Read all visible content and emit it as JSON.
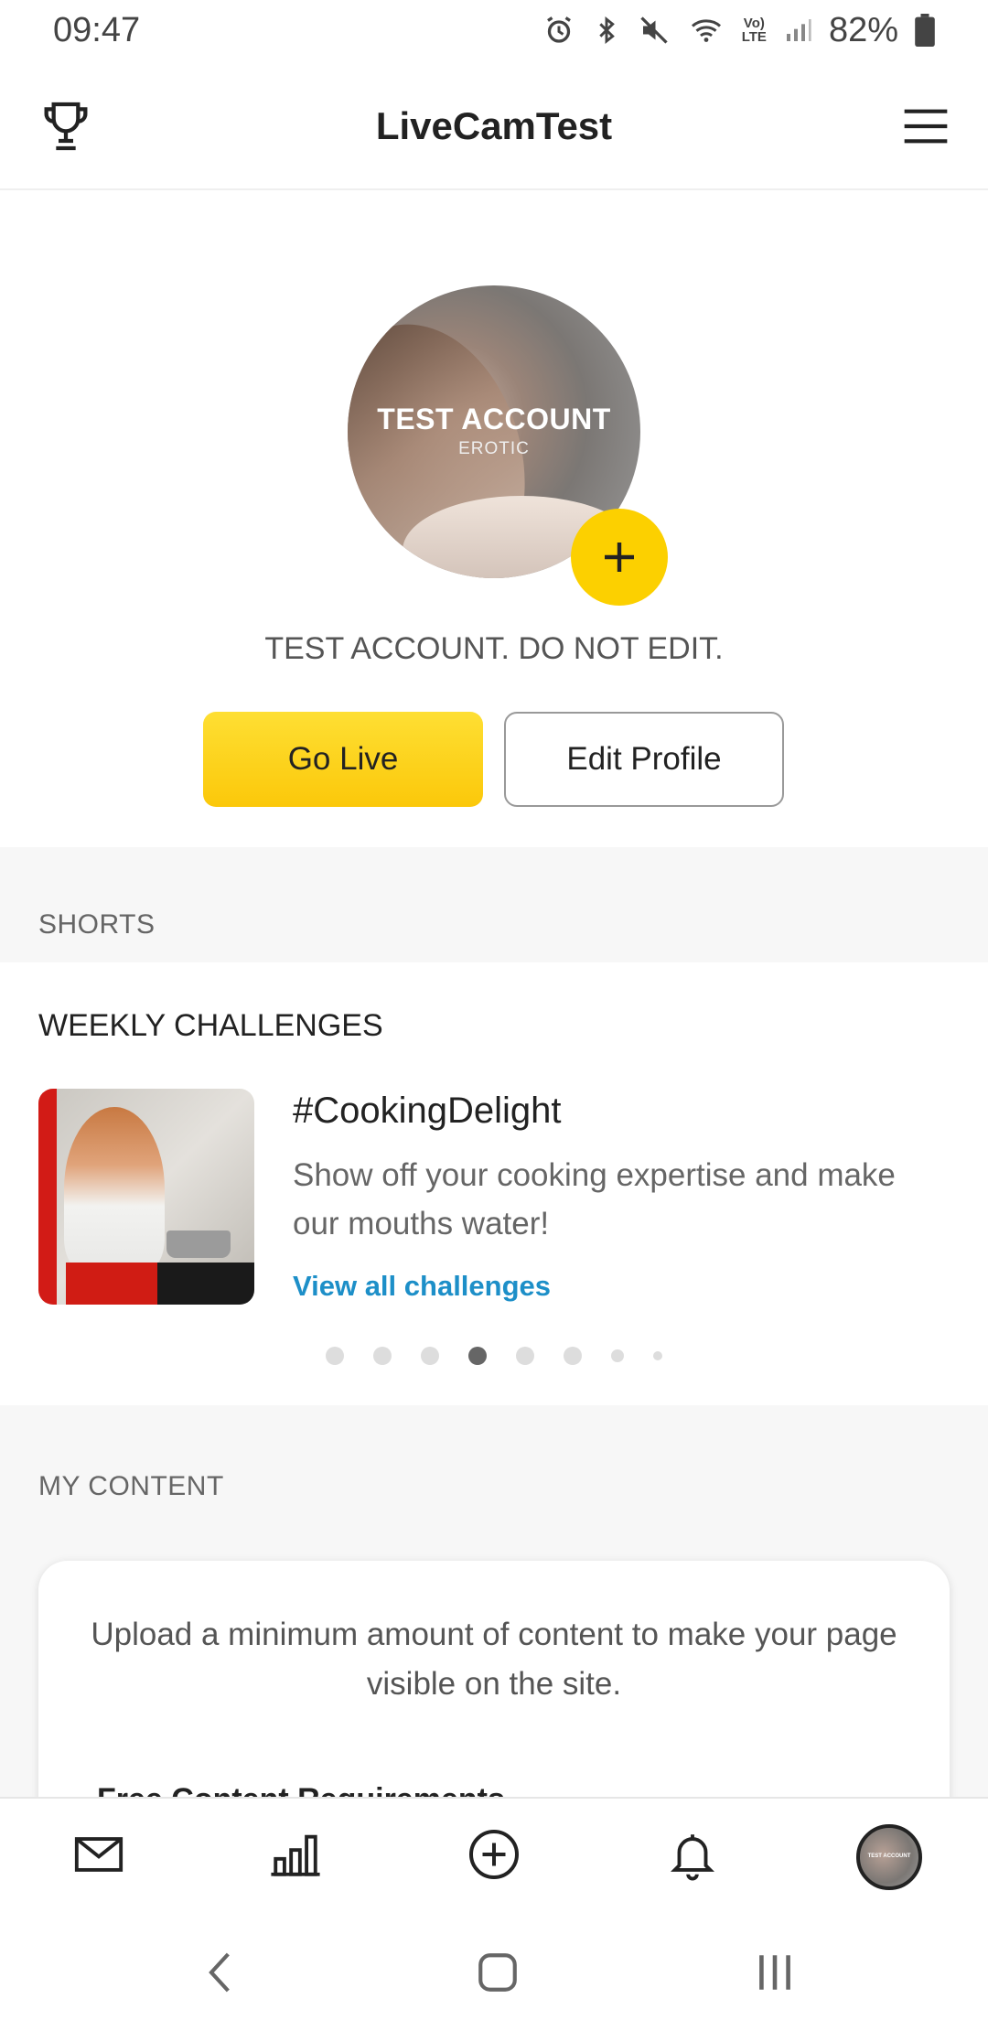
{
  "status_bar": {
    "time": "09:47",
    "battery": "82%",
    "network": "LTE",
    "icons": [
      "alarm-icon",
      "bluetooth-icon",
      "mute-icon",
      "wifi-icon",
      "volte-icon",
      "signal-icon",
      "battery-icon"
    ]
  },
  "app_bar": {
    "title": "LiveCamTest",
    "left_icon": "trophy-icon",
    "right_icon": "menu-icon"
  },
  "profile": {
    "avatar_title": "TEST ACCOUNT",
    "avatar_subtitle": "EROTIC",
    "name": "TEST ACCOUNT. DO NOT EDIT.",
    "go_live_label": "Go Live",
    "edit_profile_label": "Edit Profile",
    "accent_color": "#fcd000"
  },
  "shorts": {
    "label": "SHORTS"
  },
  "weekly_challenges": {
    "title": "WEEKLY CHALLENGES",
    "challenge_name": "#CookingDelight",
    "challenge_desc": "Show off your cooking expertise and make our mouths water!",
    "link_label": "View all challenges",
    "link_color": "#1d8fc8",
    "pager": {
      "count": 8,
      "active_index": 3
    }
  },
  "my_content": {
    "label": "MY CONTENT",
    "card_text": "Upload a minimum amount of content to make your page visible on the site.",
    "requirements_title": "Free Content Requirements"
  },
  "bottom_nav": {
    "items": [
      "mail-icon",
      "stats-icon",
      "add-icon",
      "bell-icon",
      "avatar"
    ]
  }
}
